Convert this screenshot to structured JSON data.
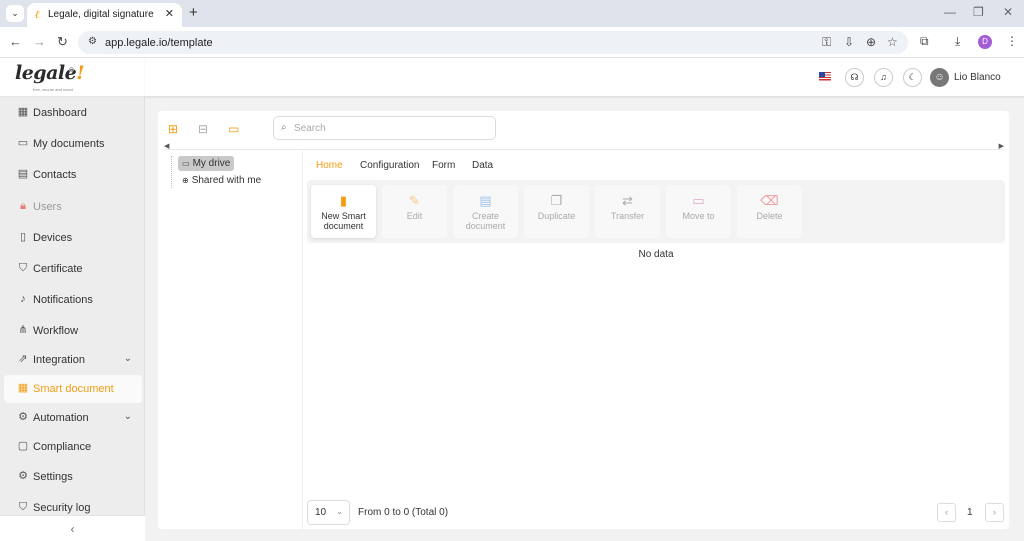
{
  "browser": {
    "tab_title": "Legale, digital signature",
    "url": "app.legale.io/template",
    "profile_initial": "D"
  },
  "logo": {
    "text": "legale",
    "bang": "!",
    "tagline": "free, secure and smart"
  },
  "sidebar": {
    "items": [
      {
        "label": "Dashboard",
        "icon": "dashboard-icon"
      },
      {
        "label": "My documents",
        "icon": "folder-icon"
      },
      {
        "label": "Contacts",
        "icon": "contacts-icon"
      },
      {
        "label": "Users",
        "icon": "lock-icon",
        "disabled": true
      },
      {
        "label": "Devices",
        "icon": "tablet-icon"
      },
      {
        "label": "Certificate",
        "icon": "shield-check-icon"
      },
      {
        "label": "Notifications",
        "icon": "bell-icon"
      },
      {
        "label": "Workflow",
        "icon": "workflow-icon"
      },
      {
        "label": "Integration",
        "icon": "external-link-icon",
        "expandable": true
      },
      {
        "label": "Smart document",
        "icon": "table-icon",
        "active": true
      },
      {
        "label": "Automation",
        "icon": "gear-icon",
        "expandable": true
      },
      {
        "label": "Compliance",
        "icon": "chat-icon"
      },
      {
        "label": "Settings",
        "icon": "gear-icon"
      },
      {
        "label": "Security log",
        "icon": "shield-check-icon"
      }
    ]
  },
  "header": {
    "user_name": "Lio Blanco"
  },
  "search": {
    "placeholder": "Search"
  },
  "tree": {
    "my_drive": "My drive",
    "shared": "Shared with me"
  },
  "tabs": [
    "Home",
    "Configuration",
    "Form",
    "Data"
  ],
  "actions": [
    {
      "label": "New Smart document",
      "icon": "file-plus-icon",
      "color": "#f39c12",
      "primary": true
    },
    {
      "label": "Edit",
      "icon": "pencil-icon",
      "color": "#f5c98a"
    },
    {
      "label": "Create document",
      "icon": "file-settings-icon",
      "color": "#9cc3e8"
    },
    {
      "label": "Duplicate",
      "icon": "copy-icon",
      "color": "#aaaaaa"
    },
    {
      "label": "Transfer",
      "icon": "transfer-icon",
      "color": "#aaaaaa"
    },
    {
      "label": "Move to",
      "icon": "folder-move-icon",
      "color": "#e2a3c7"
    },
    {
      "label": "Delete",
      "icon": "trash-icon",
      "color": "#ee9999"
    }
  ],
  "table": {
    "empty_text": "No data"
  },
  "pagination": {
    "page_size": "10",
    "range_text": "From 0 to 0 (Total 0)",
    "current_page": "1"
  },
  "colors": {
    "accent": "#f39c12"
  }
}
